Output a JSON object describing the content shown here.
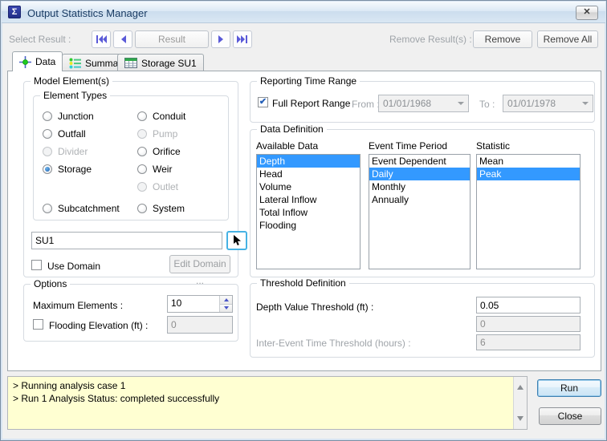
{
  "window": {
    "title": "Output Statistics Manager",
    "icon": "Σ",
    "close_glyph": "✕"
  },
  "toolbar": {
    "select_result_label": "Select Result :",
    "result_button": "Result",
    "remove_results_label": "Remove Result(s) :",
    "remove_button": "Remove",
    "remove_all_button": "Remove All"
  },
  "tabs": {
    "data": "Data",
    "summary": "Summary",
    "storage": "Storage SU1"
  },
  "model_elements": {
    "group_label": "Model Element(s)",
    "element_types_label": "Element Types",
    "left_radios": [
      {
        "label": "Junction"
      },
      {
        "label": "Outfall"
      },
      {
        "label": "Divider",
        "disabled": true
      },
      {
        "label": "Storage",
        "selected": true
      },
      {
        "label": "Subcatchment"
      }
    ],
    "right_radios": [
      {
        "label": "Conduit"
      },
      {
        "label": "Pump",
        "disabled": true
      },
      {
        "label": "Orifice"
      },
      {
        "label": "Weir"
      },
      {
        "label": "Outlet",
        "disabled": true
      },
      {
        "label": "System"
      }
    ],
    "element_name_value": "SU1",
    "use_domain_label": "Use Domain",
    "use_domain_checked": false,
    "edit_domain_button": "Edit Domain ..."
  },
  "options": {
    "group_label": "Options",
    "maximum_elements_label": "Maximum Elements :",
    "maximum_elements_value": "10",
    "flooding_label": "Flooding Elevation (ft) :",
    "flooding_checked": false,
    "flooding_value": "0"
  },
  "reporting": {
    "group_label": "Reporting Time Range",
    "full_report_label": "Full Report Range",
    "full_report_checked": true,
    "from_label": "From :",
    "from_value": "01/01/1968",
    "to_label": "To :",
    "to_value": "01/01/1978"
  },
  "data_definition": {
    "group_label": "Data Definition",
    "columns": [
      {
        "header": "Available Data",
        "items": [
          "Depth",
          "Head",
          "Volume",
          "Lateral Inflow",
          "Total Inflow",
          "Flooding"
        ],
        "selected": "Depth"
      },
      {
        "header": "Event Time Period",
        "items": [
          "Event Dependent",
          "Daily",
          "Monthly",
          "Annually"
        ],
        "selected": "Daily"
      },
      {
        "header": "Statistic",
        "items": [
          "Mean",
          "Peak"
        ],
        "selected": "Peak"
      }
    ]
  },
  "threshold": {
    "group_label": "Threshold Definition",
    "depth_label": "Depth Value Threshold (ft) :",
    "depth_value": "0.05",
    "secondary_value": "0",
    "inter_event_label": "Inter-Event Time Threshold (hours) :",
    "inter_event_value": "6"
  },
  "log": {
    "lines": [
      "> Running analysis case 1",
      "> Run 1 Analysis Status: completed successfully"
    ]
  },
  "actions": {
    "run_label": "Run",
    "close_label": "Close"
  },
  "colors": {
    "selection": "#3399FF",
    "log_bg": "#FFFFD2",
    "accent_arrow": "#5A5AD8",
    "titlebar_text": "#1A3C64"
  }
}
